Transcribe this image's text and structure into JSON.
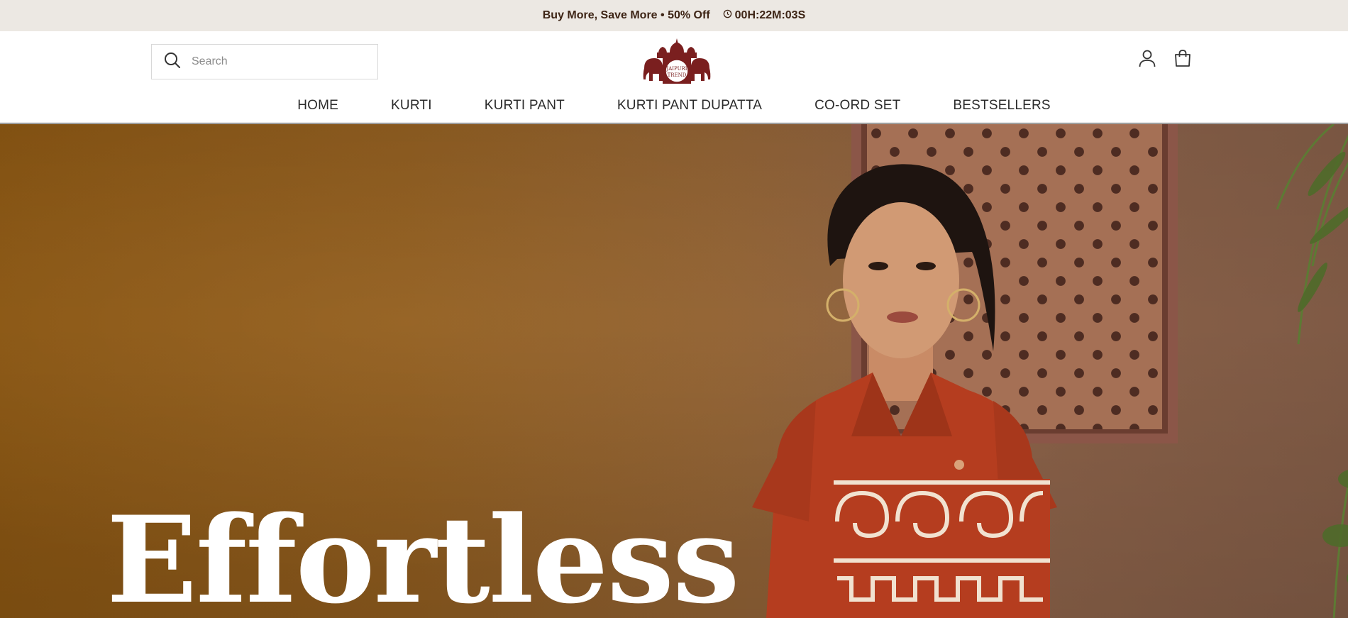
{
  "announcement": {
    "promo": "Buy More, Save More • 50% Off",
    "timer": "00H:22M:03S"
  },
  "header": {
    "search": {
      "placeholder": "Search"
    },
    "logo": {
      "alt": "JAIPURI TREND",
      "line1": "JAIPURI",
      "line2": "TREND"
    },
    "icons": [
      "account-icon",
      "cart-icon"
    ]
  },
  "nav": {
    "items": [
      {
        "label": "HOME"
      },
      {
        "label": "KURTI"
      },
      {
        "label": "KURTI PANT"
      },
      {
        "label": "KURTI PANT DUPATTA"
      },
      {
        "label": "CO-ORD SET"
      },
      {
        "label": "BESTSELLERS"
      }
    ]
  },
  "hero": {
    "title": "Effortless"
  },
  "colors": {
    "announcement_bg": "#ece8e3",
    "brand": "#7a1f1f",
    "hero_bg": "#8a5a1e",
    "dress": "#b53d1f"
  }
}
